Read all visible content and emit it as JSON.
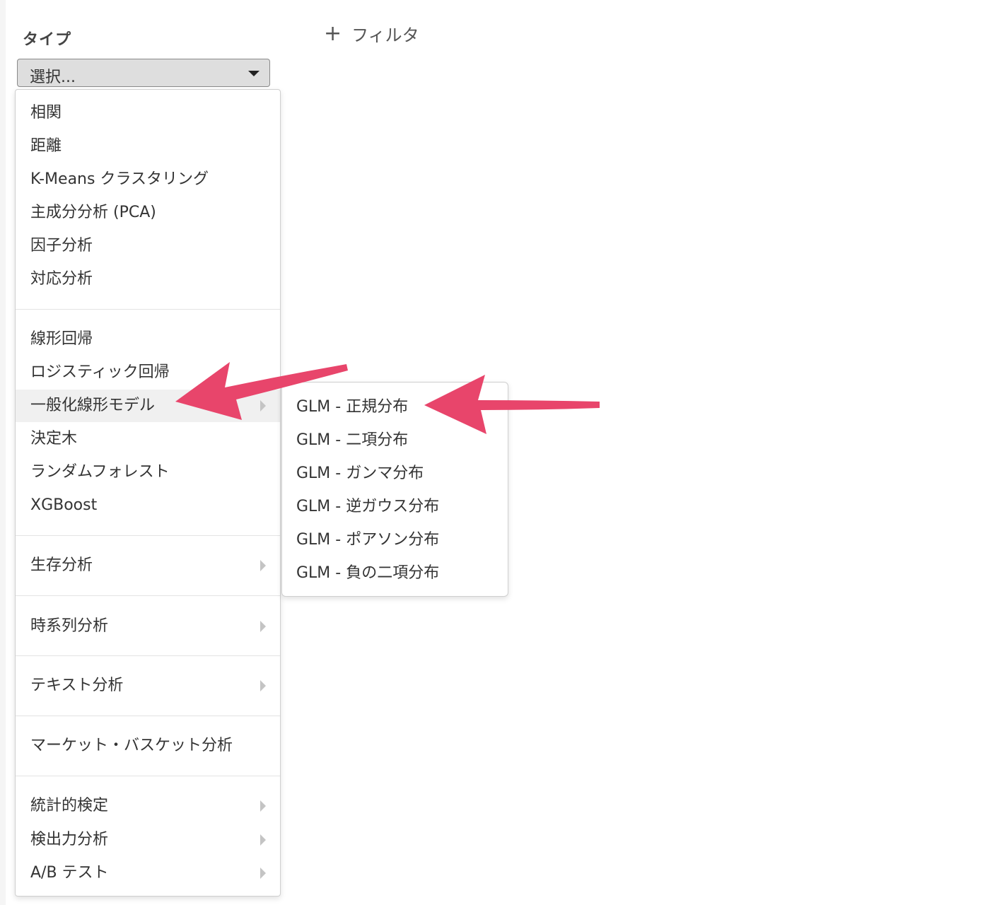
{
  "header": {
    "type_label": "タイプ",
    "add_filter_label": "フィルタ",
    "add_filter_icon": "plus-icon"
  },
  "select": {
    "value": "選択..."
  },
  "menu": {
    "items": [
      {
        "label": "相関",
        "submenu": false
      },
      {
        "label": "距離",
        "submenu": false
      },
      {
        "label": "K-Means クラスタリング",
        "submenu": false
      },
      {
        "label": "主成分分析 (PCA)",
        "submenu": false
      },
      {
        "label": "因子分析",
        "submenu": false
      },
      {
        "label": "対応分析",
        "submenu": false
      },
      {
        "label": "線形回帰",
        "submenu": false
      },
      {
        "label": "ロジスティック回帰",
        "submenu": false
      },
      {
        "label": "一般化線形モデル",
        "submenu": true,
        "active": true
      },
      {
        "label": "決定木",
        "submenu": false
      },
      {
        "label": "ランダムフォレスト",
        "submenu": false
      },
      {
        "label": "XGBoost",
        "submenu": false
      },
      {
        "label": "生存分析",
        "submenu": true
      },
      {
        "label": "時系列分析",
        "submenu": true
      },
      {
        "label": "テキスト分析",
        "submenu": true
      },
      {
        "label": "マーケット・バスケット分析",
        "submenu": false
      },
      {
        "label": "統計的検定",
        "submenu": true
      },
      {
        "label": "検出力分析",
        "submenu": true
      },
      {
        "label": "A/B テスト",
        "submenu": true
      }
    ]
  },
  "submenu": {
    "items": [
      "GLM - 正規分布",
      "GLM - 二項分布",
      "GLM - ガンマ分布",
      "GLM - 逆ガウス分布",
      "GLM - ポアソン分布",
      "GLM - 負の二項分布"
    ]
  },
  "colors": {
    "annotation_arrow": "#e8456b",
    "hover_bg": "#f0f0f0",
    "select_bg": "#dedede"
  }
}
